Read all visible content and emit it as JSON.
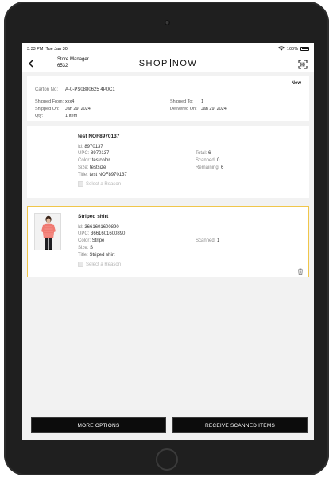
{
  "status_bar": {
    "time": "3:33 PM",
    "date": "Tue Jan 30",
    "battery": "100%",
    "wifi_icon": "wifi-icon",
    "battery_icon": "battery-icon"
  },
  "header": {
    "back_icon": "chevron-left-icon",
    "store_title": "Store Manager",
    "store_number": "6532",
    "brand_left": "SHOP",
    "brand_right": "NOW",
    "scan_icon": "barcode-scan-icon"
  },
  "carton": {
    "status": "New",
    "carton_no_label": "Carton No:",
    "carton_no": "A-0-PS0880625 4P0C1",
    "shipped_from_label": "Shipped From:",
    "shipped_from": "xxx4",
    "shipped_to_label": "Shipped To:",
    "shipped_to": "1",
    "shipped_on_label": "Shipped On:",
    "shipped_on": "Jan 29, 2024",
    "delivered_on_label": "Delivered On:",
    "delivered_on": "Jan 29, 2024",
    "qty_label": "Qty:",
    "qty": "1 Item"
  },
  "items": [
    {
      "title": "test NOF8970137",
      "id_label": "Id:",
      "id": "8970137",
      "upc_label": "UPC:",
      "upc": "8970137",
      "color_label": "Color:",
      "color": "testcolor",
      "size_label": "Size:",
      "size": "testsize",
      "title_label": "Title:",
      "title_value": "test NOF8970137",
      "total_label": "Total:",
      "total": "6",
      "scanned_label": "Scanned:",
      "scanned": "0",
      "remaining_label": "Remaining:",
      "remaining": "6",
      "reason_placeholder": "Select a Reason"
    },
    {
      "title": "Striped shirt",
      "id_label": "Id:",
      "id": "3661601600890",
      "upc_label": "UPC:",
      "upc": "3661601600890",
      "color_label": "Color:",
      "color": "Stripe",
      "size_label": "Size:",
      "size": "S",
      "title_label": "Title:",
      "title_value": "Striped shirt",
      "scanned_label": "Scanned:",
      "scanned": "1",
      "reason_placeholder": "Select a Reason",
      "image_icon": "product-photo-icon",
      "trash_icon": "trash-icon"
    }
  ],
  "footer": {
    "more_options": "MORE OPTIONS",
    "receive_scanned": "RECEIVE SCANNED ITEMS"
  },
  "colors": {
    "selected_border": "#f0c64a",
    "button_bg": "#0c0c0c",
    "device_bezel": "#1f1f1f"
  }
}
